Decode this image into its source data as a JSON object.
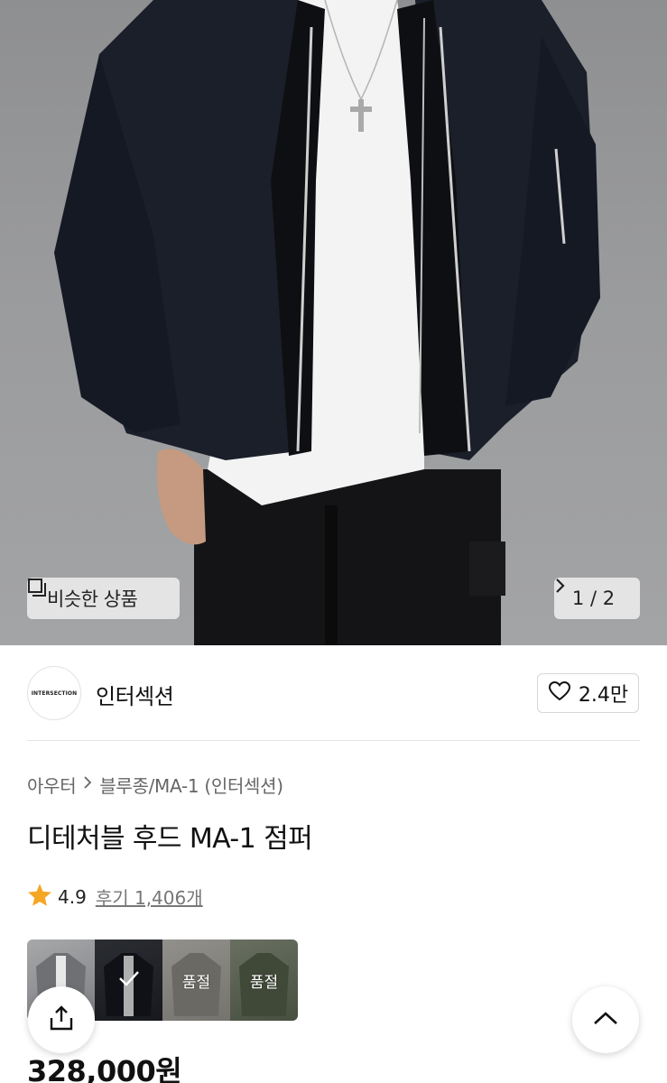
{
  "hero": {
    "similar_label": "비슷한 상품",
    "counter": "1 / 2",
    "similar_icon": "similar-items-icon",
    "next_icon": "chevron-right-icon"
  },
  "brand": {
    "logo_text": "INTERSECTION",
    "name": "인터섹션",
    "likes": "2.4만",
    "like_icon": "heart-outline-icon"
  },
  "product": {
    "breadcrumb": [
      "아우터",
      "블루종/MA-1 (인터섹션)"
    ],
    "title": "디테처블 후드 MA-1 점퍼",
    "rating": "4.9",
    "reviews": "후기 1,406개",
    "price": "328,000원"
  },
  "swatches": [
    {
      "color": "#8c8d8f",
      "status": "",
      "selected": false
    },
    {
      "color": "#1e2128",
      "status": "",
      "selected": true
    },
    {
      "color": "#a9a79f",
      "status": "품절",
      "selected": false
    },
    {
      "color": "#6f7a63",
      "status": "품절",
      "selected": false
    }
  ],
  "colors": {
    "star": "#f5a623",
    "jacket": "#1b1f2a"
  }
}
